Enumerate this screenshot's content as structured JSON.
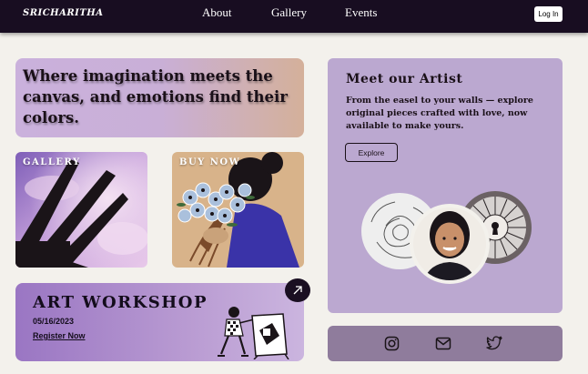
{
  "nav": {
    "logo": "SRICHARITHA",
    "links": [
      "About",
      "Gallery",
      "Events"
    ],
    "login_label": "Log In"
  },
  "hero": {
    "text": "Where imagination meets the canvas, and emotions find their colors."
  },
  "tiles": {
    "gallery_label": "GALLERY",
    "buy_label": "BUY NOW"
  },
  "workshop": {
    "title": "ART WORKSHOP",
    "date": "05/16/2023",
    "register_label": "Register Now"
  },
  "artist": {
    "title": "Meet our Artist",
    "description": "From the easel to your walls — explore original pieces crafted with love, now available to make yours.",
    "explore_label": "Explore"
  },
  "social": {
    "icons": [
      "instagram-icon",
      "mail-icon",
      "twitter-icon"
    ]
  },
  "colors": {
    "nav_bg": "#180d21",
    "page_bg": "#f3f1ec",
    "artist_bg": "#bba8d0",
    "social_bg": "#8f7c9c"
  }
}
